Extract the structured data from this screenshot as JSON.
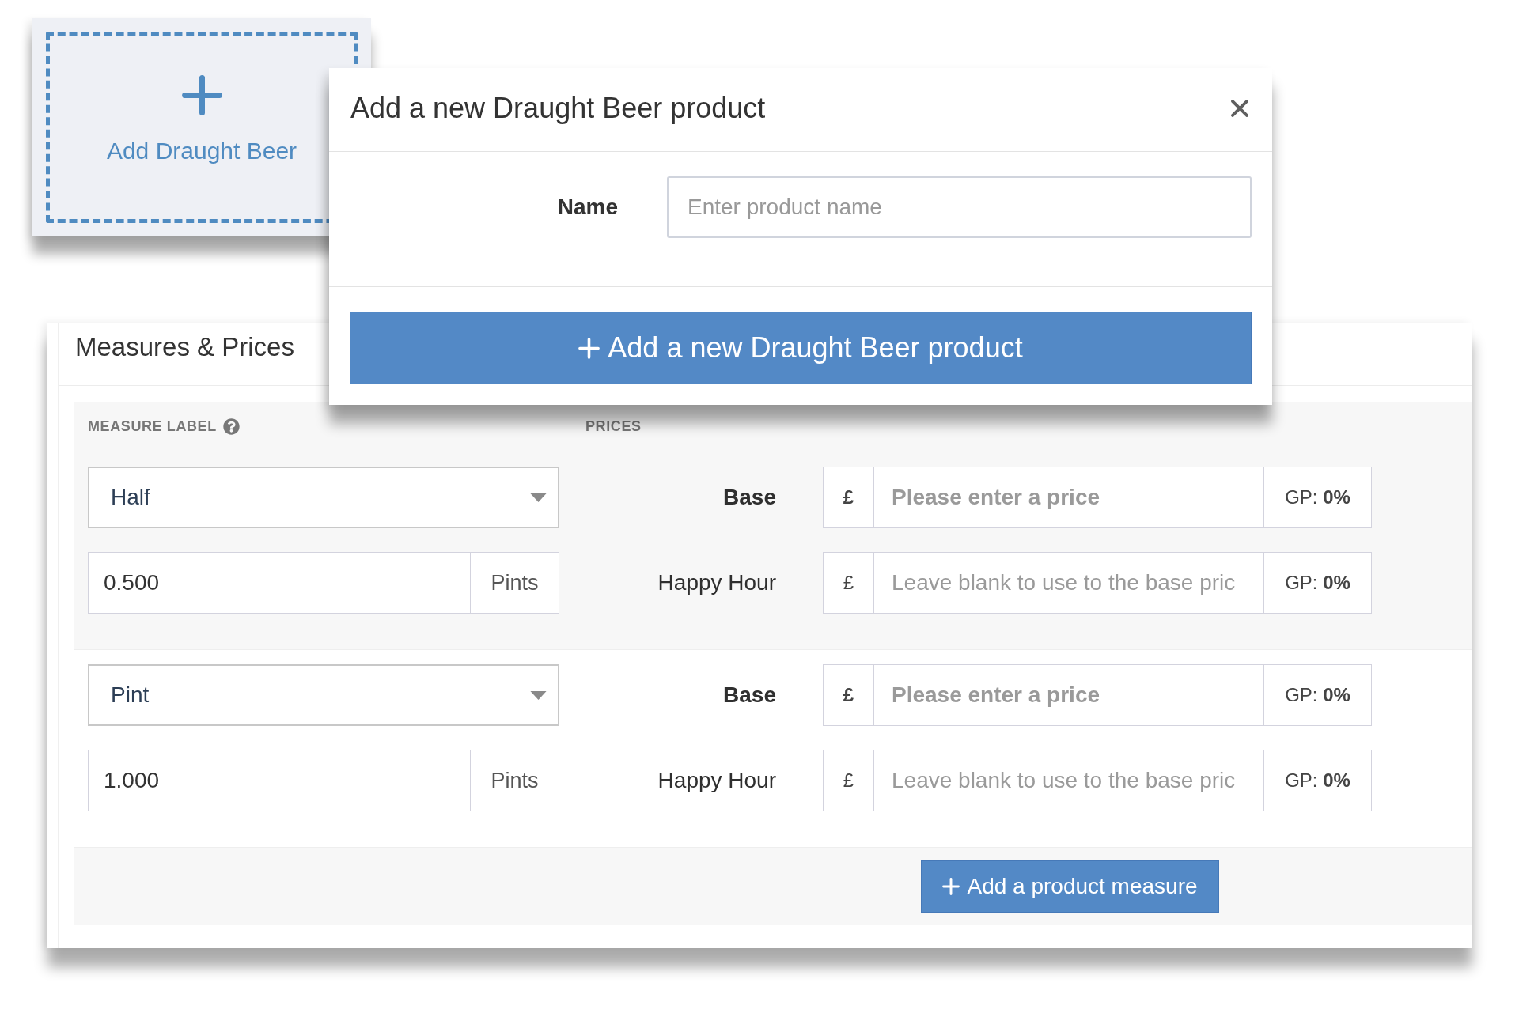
{
  "add_tile": {
    "label": "Add Draught Beer"
  },
  "modal": {
    "title": "Add a new Draught Beer product",
    "fields": [
      {
        "label": "Name",
        "placeholder": "Enter product name"
      }
    ],
    "submit_button": {
      "label": "Add a new Draught Beer product"
    }
  },
  "measures_panel": {
    "title": "Measures & Prices",
    "columns": [
      {
        "label": "MEASURE LABEL",
        "help": true
      },
      {
        "label": "PRICES",
        "help": false
      }
    ],
    "measures": [
      {
        "label": "Half",
        "quantity": "0.500",
        "unit": "Pints",
        "prices": [
          {
            "kind": "primary",
            "label": "Base",
            "currency": "£",
            "placeholder": "Please enter a price",
            "gross_profit": "GP: **0%**"
          },
          {
            "kind": "secondary",
            "label": "Happy Hour",
            "currency": "£",
            "placeholder": "Leave blank to use to the base pric",
            "gross_profit": "GP: **0%**"
          }
        ]
      },
      {
        "label": "Pint",
        "quantity": "1.000",
        "unit": "Pints",
        "prices": [
          {
            "kind": "primary",
            "label": "Base",
            "currency": "£",
            "placeholder": "Please enter a price",
            "gross_profit": "GP: **0%**"
          },
          {
            "kind": "secondary",
            "label": "Happy Hour",
            "currency": "£",
            "placeholder": "Leave blank to use to the base pric",
            "gross_profit": "GP: **0%**"
          }
        ]
      }
    ],
    "add_button": {
      "label": "Add a product measure"
    }
  }
}
